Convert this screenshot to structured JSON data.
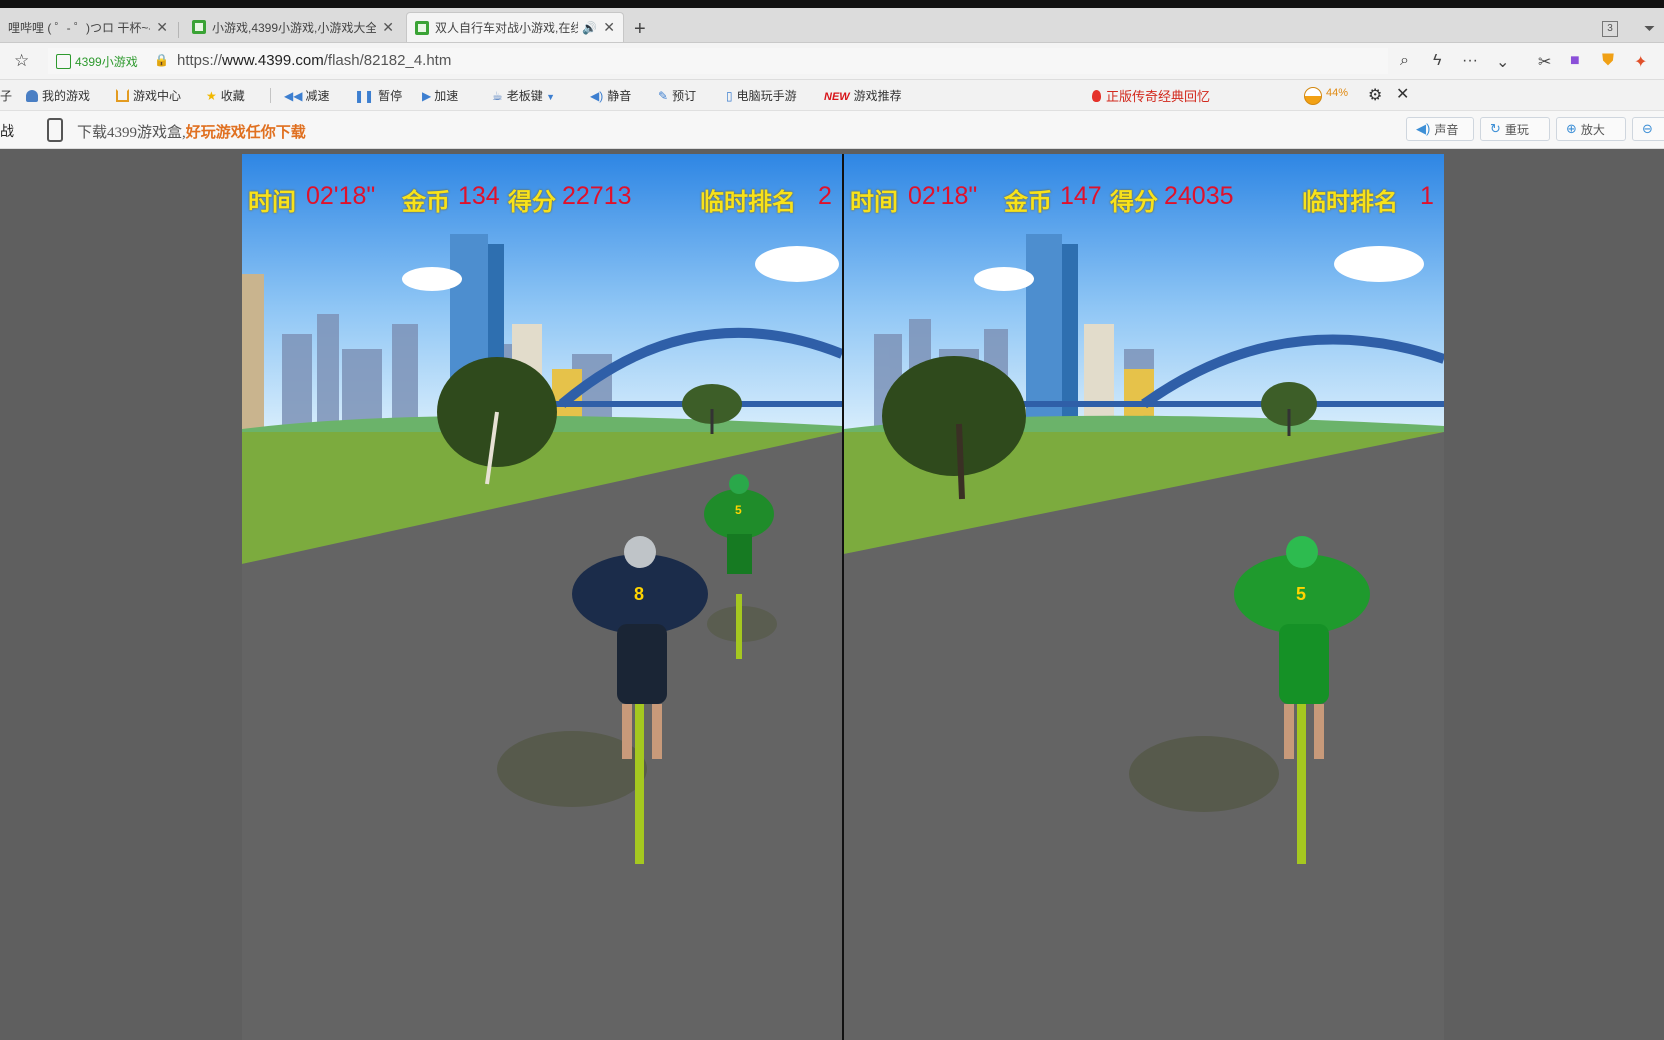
{
  "browser": {
    "tabs": [
      {
        "title": "哩哔哩 ( ゜- ゜)つロ 干杯~-b"
      },
      {
        "title": "小游戏,4399小游戏,小游戏大全"
      },
      {
        "title": "双人自行车对战小游戏,在线"
      }
    ],
    "tab_count": "3",
    "new_tab_symbol": "+",
    "site_badge": "4399小游戏",
    "url_prefix": "https://",
    "url_host": "www.4399.com",
    "url_path": "/flash/82182_4.htm"
  },
  "toolbar": {
    "edge_left": "子",
    "items": [
      {
        "label": "我的游戏"
      },
      {
        "label": "游戏中心"
      },
      {
        "label": "收藏"
      },
      {
        "label": "减速"
      },
      {
        "label": "暂停"
      },
      {
        "label": "加速"
      },
      {
        "label": "老板键"
      },
      {
        "label": "静音"
      },
      {
        "label": "预订"
      },
      {
        "label": "电脑玩手游"
      },
      {
        "label": "游戏推荐",
        "badge": "NEW"
      }
    ],
    "promo": "正版传奇经典回忆",
    "percent": "44%"
  },
  "download_bar": {
    "edge_left": "战",
    "text_a": "下载4399游戏盒,",
    "text_b": "好玩游戏任你下载",
    "buttons": [
      {
        "label": "声音"
      },
      {
        "label": "重玩"
      },
      {
        "label": "放大"
      }
    ]
  },
  "game": {
    "players": [
      {
        "time_label": "时间",
        "time": "02'18\"",
        "coin_label": "金币",
        "coins": "134",
        "score_label": "得分",
        "score": "22713",
        "rank_label": "临时排名",
        "rank": "2",
        "rider_number": "8"
      },
      {
        "time_label": "时间",
        "time": "02'18\"",
        "coin_label": "金币",
        "coins": "147",
        "score_label": "得分",
        "score": "24035",
        "rank_label": "临时排名",
        "rank": "1",
        "rider_number": "5"
      }
    ],
    "opponent_number": "5"
  }
}
